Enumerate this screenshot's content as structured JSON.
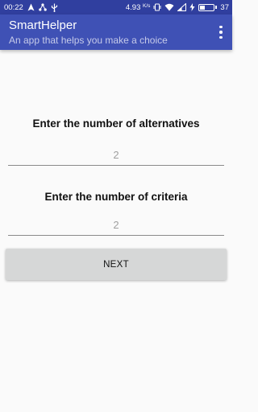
{
  "status_bar": {
    "time": "00:22",
    "speed": "4.93",
    "speed_unit": "K/s",
    "battery": "37",
    "battery_level": 0.37
  },
  "app_bar": {
    "title": "SmartHelper",
    "subtitle": "An app that helps you make a choice",
    "menu_icon": "more-vert-icon"
  },
  "form": {
    "alternatives_label": "Enter the number of alternatives",
    "alternatives_placeholder": "2",
    "criteria_label": "Enter the number of criteria",
    "criteria_placeholder": "2",
    "next_label": "NEXT"
  },
  "colors": {
    "primary": "#3f51b5",
    "primary_dark": "#303f9f",
    "button": "#d6d7d7"
  }
}
